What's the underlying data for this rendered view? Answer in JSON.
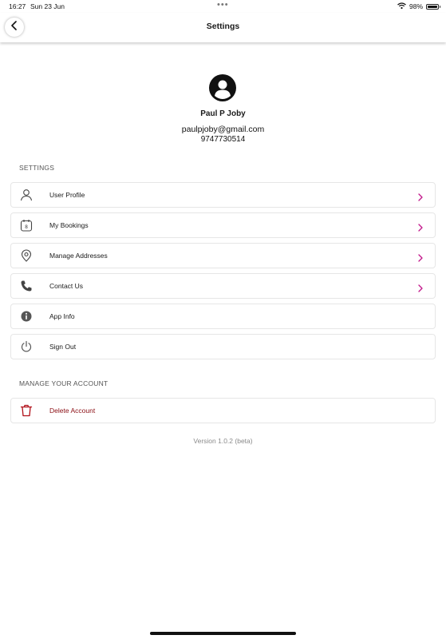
{
  "status_bar": {
    "time": "16:27",
    "date": "Sun 23 Jun",
    "dots": "•••",
    "battery_text": "98%",
    "battery_level": 0.98,
    "icons": [
      "wifi-icon",
      "battery-icon"
    ]
  },
  "nav": {
    "title": "Settings",
    "back_icon": "chevron-left-icon"
  },
  "profile": {
    "avatar_icon": "user-avatar-icon",
    "name": "Paul P Joby",
    "email": "paulpjoby@gmail.com",
    "phone": "9747730514"
  },
  "settings_section": {
    "header": "SETTINGS",
    "items": [
      {
        "label": "User Profile",
        "icon": "user-icon",
        "has_chevron": true
      },
      {
        "label": "My Bookings",
        "icon": "calendar-icon",
        "has_chevron": true
      },
      {
        "label": "Manage Addresses",
        "icon": "location-pin-icon",
        "has_chevron": true
      },
      {
        "label": "Contact Us",
        "icon": "phone-icon",
        "has_chevron": true
      },
      {
        "label": "App Info",
        "icon": "info-icon",
        "has_chevron": false
      },
      {
        "label": "Sign Out",
        "icon": "power-icon",
        "has_chevron": false
      }
    ]
  },
  "account_section": {
    "header": "MANAGE YOUR ACCOUNT",
    "items": [
      {
        "label": "Delete Account",
        "icon": "trash-icon",
        "has_chevron": false
      }
    ]
  },
  "version": "Version 1.0.2 (beta)",
  "colors": {
    "chevron_accent": "#c2188a",
    "danger": "#8b0e14",
    "section_header": "#555555",
    "version_text": "#8a8a8a"
  },
  "calendar_icon_day": "8"
}
